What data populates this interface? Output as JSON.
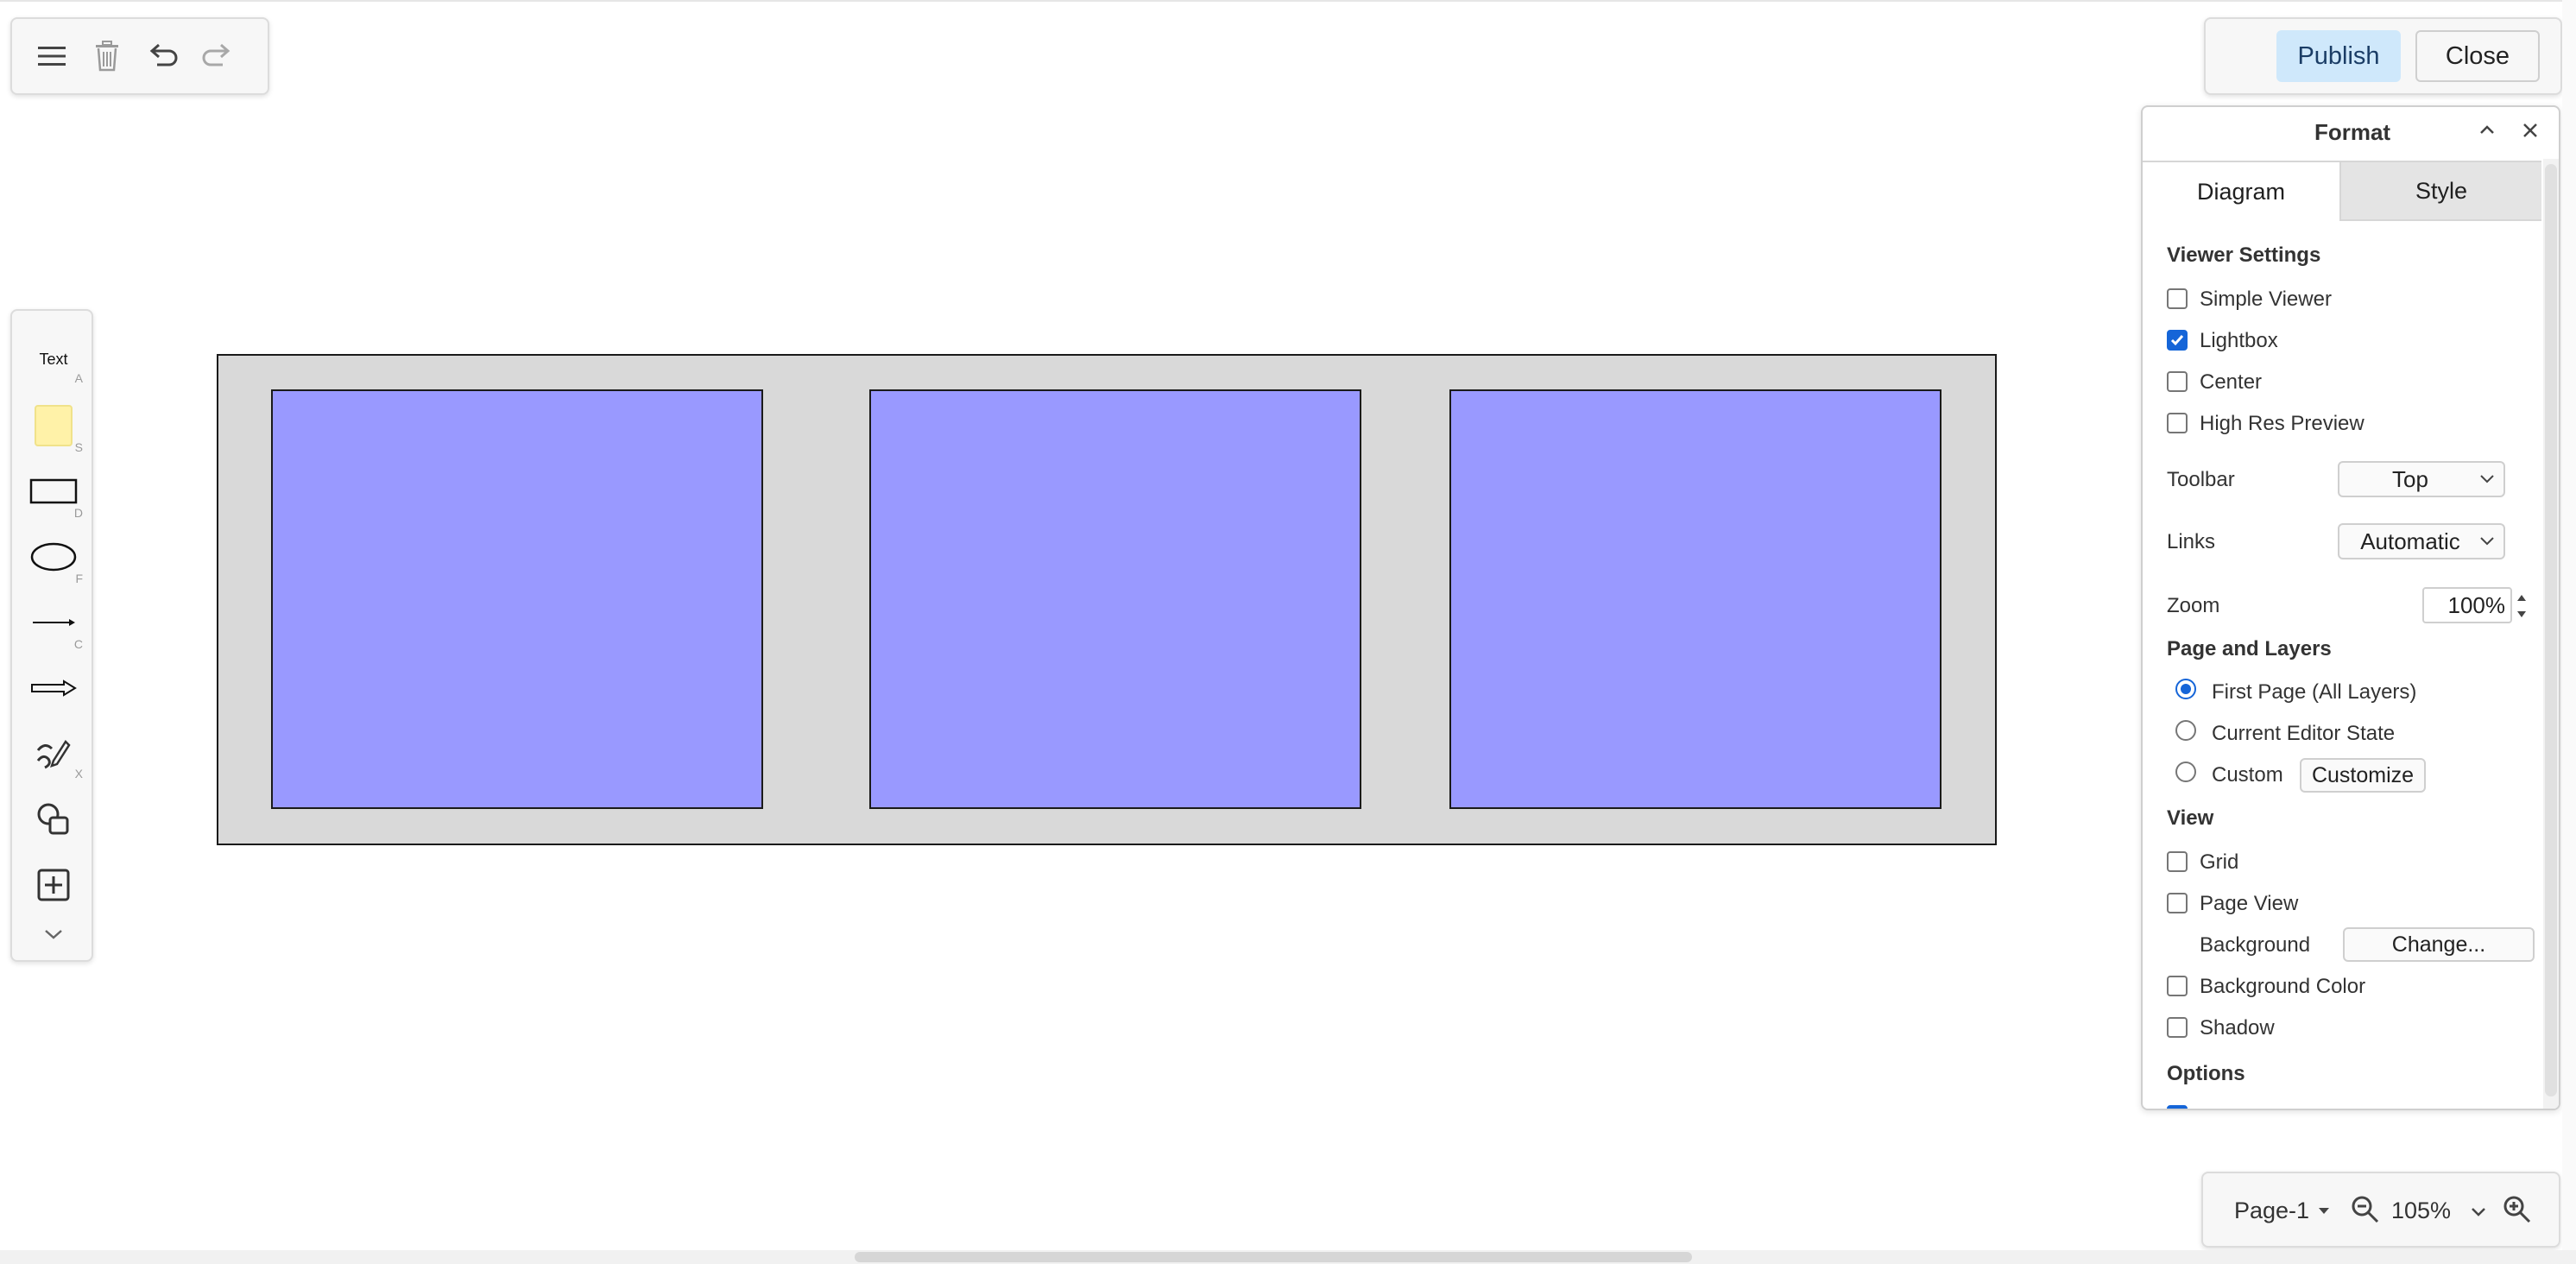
{
  "toolbar": {
    "menu_icon": "hamburger-menu-icon",
    "delete_icon": "trash-icon",
    "undo_icon": "undo-icon",
    "redo_icon": "redo-icon"
  },
  "header_actions": {
    "publish_label": "Publish",
    "close_label": "Close"
  },
  "shapes_sidebar": {
    "text_label": "Text",
    "items": [
      {
        "name": "text",
        "key": "A"
      },
      {
        "name": "sticky-note",
        "key": "S"
      },
      {
        "name": "rectangle",
        "key": "D"
      },
      {
        "name": "ellipse",
        "key": "F"
      },
      {
        "name": "line",
        "key": "C"
      },
      {
        "name": "arrow",
        "key": ""
      },
      {
        "name": "freehand",
        "key": "X"
      },
      {
        "name": "shapes",
        "key": ""
      },
      {
        "name": "insert",
        "key": ""
      }
    ]
  },
  "diagram": {
    "container_fill": "#d9d9d9",
    "box_fill": "#9999ff",
    "stroke": "#1a1a1a",
    "box_count": 3
  },
  "format_panel": {
    "title": "Format",
    "tabs": [
      {
        "label": "Diagram",
        "active": true
      },
      {
        "label": "Style",
        "active": false
      }
    ],
    "viewer_settings": {
      "title": "Viewer Settings",
      "options": [
        {
          "label": "Simple Viewer",
          "checked": false
        },
        {
          "label": "Lightbox",
          "checked": true
        },
        {
          "label": "Center",
          "checked": false
        },
        {
          "label": "High Res Preview",
          "checked": false
        }
      ]
    },
    "toolbar_setting": {
      "label": "Toolbar",
      "value": "Top"
    },
    "links_setting": {
      "label": "Links",
      "value": "Automatic"
    },
    "zoom_setting": {
      "label": "Zoom",
      "value": "100%"
    },
    "page_and_layers": {
      "title": "Page and Layers",
      "options": [
        {
          "label": "First Page (All Layers)",
          "selected": true
        },
        {
          "label": "Current Editor State",
          "selected": false
        },
        {
          "label": "Custom",
          "selected": false
        }
      ],
      "customize_label": "Customize"
    },
    "view": {
      "title": "View",
      "grid_label": "Grid",
      "grid_checked": false,
      "page_view_label": "Page View",
      "page_view_checked": false,
      "background_label": "Background",
      "change_label": "Change...",
      "background_color_label": "Background Color",
      "background_color_checked": false,
      "shadow_label": "Shadow",
      "shadow_checked": false
    },
    "options_title": "Options"
  },
  "page_bar": {
    "page_label": "Page-1",
    "zoom_value": "105%"
  },
  "colors": {
    "accent_blue": "#1565d8",
    "publish_bg": "#cfe8fb"
  }
}
